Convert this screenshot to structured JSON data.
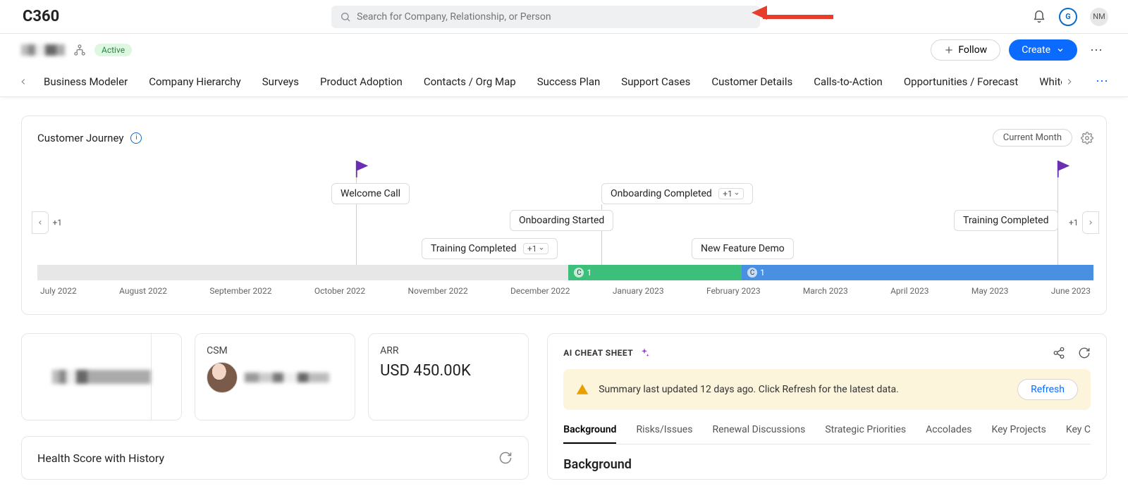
{
  "app_title": "C360",
  "search": {
    "placeholder": "Search for Company, Relationship, or Person"
  },
  "top_right": {
    "badge_letter": "G",
    "user_initials": "NM"
  },
  "sub_header": {
    "status": "Active",
    "follow_label": "Follow",
    "create_label": "Create"
  },
  "tabs": [
    "Business Modeler",
    "Company Hierarchy",
    "Surveys",
    "Product Adoption",
    "Contacts / Org Map",
    "Success Plan",
    "Support Cases",
    "Customer Details",
    "Calls-to-Action",
    "Opportunities / Forecast",
    "Whitespace"
  ],
  "journey": {
    "title": "Customer Journey",
    "current_month_label": "Current Month",
    "side_more": "+1",
    "events": {
      "welcome_call": "Welcome Call",
      "training1": "Training Completed",
      "training1_more": "+1",
      "onboarding_started": "Onboarding Started",
      "onboarding_completed": "Onboarding Completed",
      "onboarding_completed_more": "+1",
      "new_feature": "New Feature Demo",
      "training2": "Training Completed"
    },
    "bars": {
      "c1": "1",
      "c2": "1"
    },
    "months": [
      "July 2022",
      "August 2022",
      "September 2022",
      "October 2022",
      "November 2022",
      "December 2022",
      "January 2023",
      "February 2023",
      "March 2023",
      "April 2023",
      "May 2023",
      "June 2023"
    ]
  },
  "metrics": {
    "csm_label": "CSM",
    "arr_label": "ARR",
    "arr_value": "USD 450.00K"
  },
  "health": {
    "title": "Health Score with History"
  },
  "cheat_sheet": {
    "title": "AI CHEAT SHEET",
    "banner_text": "Summary last updated 12 days ago. Click Refresh for the latest data.",
    "refresh_label": "Refresh",
    "tabs": [
      "Background",
      "Risks/Issues",
      "Renewal Discussions",
      "Strategic Priorities",
      "Accolades",
      "Key Projects",
      "Key C"
    ],
    "section_heading": "Background"
  }
}
